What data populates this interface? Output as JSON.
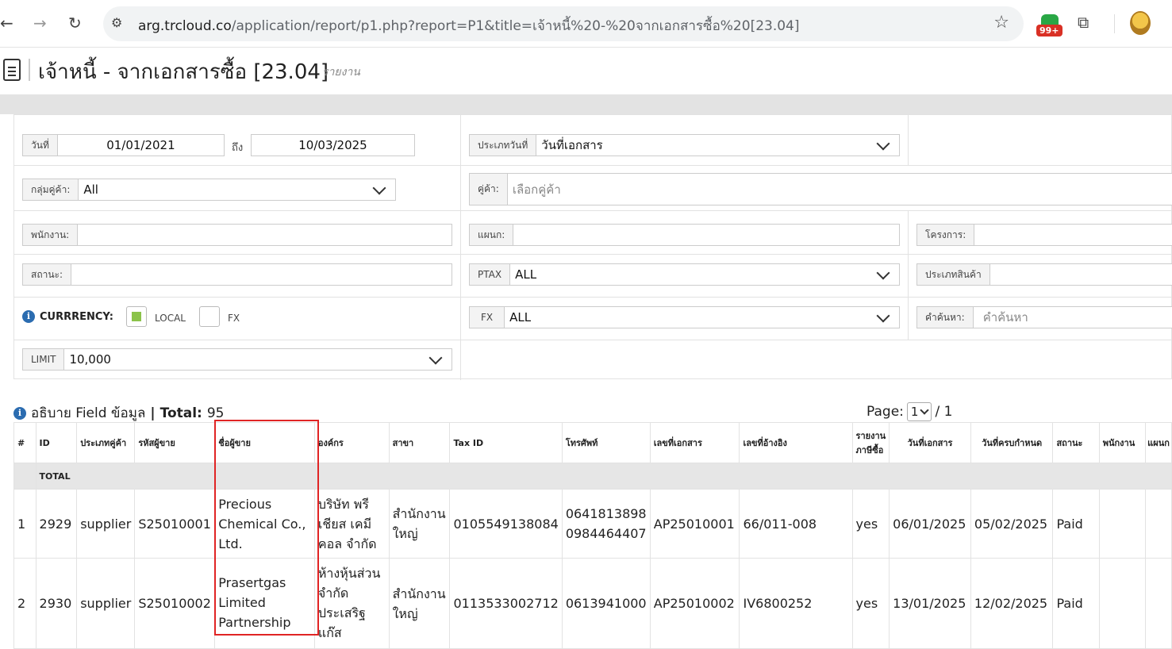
{
  "browser": {
    "url_host": "arg.trcloud.co",
    "url_path": "/application/report/p1.php?report=P1&title=เจ้าหนี้%20-%20จากเอกสารซื้อ%20[23.04]",
    "extension_badge": "99+"
  },
  "page": {
    "title": "เจ้าหนี้ - จากเอกสารซื้อ [23.04]",
    "subtitle": "รายงาน"
  },
  "filters": {
    "date_label": "วันที่",
    "date_from": "01/01/2021",
    "to_label": "ถึง",
    "date_to": "10/03/2025",
    "date_type_label": "ประเภทวันที่",
    "date_type_value": "วันที่เอกสาร",
    "customer_group_label": "กลุ่มคู่ค้า:",
    "customer_group_value": "All",
    "partner_label": "คู่ค้า:",
    "partner_placeholder": "เลือกคู่ค้า",
    "employee_label": "พนักงาน:",
    "employee_value": "",
    "department_label": "แผนก:",
    "department_value": "",
    "project_label": "โครงการ:",
    "project_value": "",
    "status_label": "สถานะ:",
    "status_value": "",
    "ptax_label": "PTAX",
    "ptax_value": "ALL",
    "product_type_label": "ประเภทสินค้า",
    "product_type_value": "",
    "currency_label": "CURRRENCY:",
    "currency_local": "LOCAL",
    "currency_fx": "FX",
    "currency_local_checked": true,
    "currency_fx_checked": false,
    "fx_label": "FX",
    "fx_value": "ALL",
    "search_label": "คำค้นหา:",
    "search_placeholder": "คำค้นหา",
    "limit_label": "LIMIT",
    "limit_value": "10,000"
  },
  "summary": {
    "field_desc": "อธิบาย Field ข้อมูล",
    "sep": "|",
    "total_label": "Total:",
    "total_value": "95",
    "page_label": "Page:",
    "page_current": "1",
    "page_of": "/ 1"
  },
  "table": {
    "headers": [
      "#",
      "ID",
      "ประเภทคู่ค้า",
      "รหัสผู้ขาย",
      "ชื่อผู้ขาย",
      "องค์กร",
      "สาขา",
      "Tax ID",
      "โทรศัพท์",
      "เลขที่เอกสาร",
      "เลขที่อ้างอิง",
      "รายงาน ภาษีซื้อ",
      "วันที่เอกสาร",
      "วันที่ครบกำหนด",
      "สถานะ",
      "พนักงาน",
      "แผนก"
    ],
    "total_label": "TOTAL",
    "rows": [
      [
        "1",
        "2929",
        "supplier",
        "S25010001",
        "Precious Chemical Co., Ltd.",
        "บริษัท พรีเชียส เคมีคอล จำกัด",
        "สำนักงานใหญ่",
        "0105549138084",
        "0641813898 0984464407",
        "AP25010001",
        "66/011-008",
        "yes",
        "06/01/2025",
        "05/02/2025",
        "Paid",
        "",
        ""
      ],
      [
        "2",
        "2930",
        "supplier",
        "S25010002",
        "Prasertgas Limited Partnership",
        "ห้างหุ้นส่วนจำกัด ประเสริฐแก๊ส",
        "สำนักงานใหญ่",
        "0113533002712",
        "0613941000",
        "AP25010002",
        "IV6800252",
        "yes",
        "13/01/2025",
        "12/02/2025",
        "Paid",
        "",
        ""
      ]
    ]
  }
}
